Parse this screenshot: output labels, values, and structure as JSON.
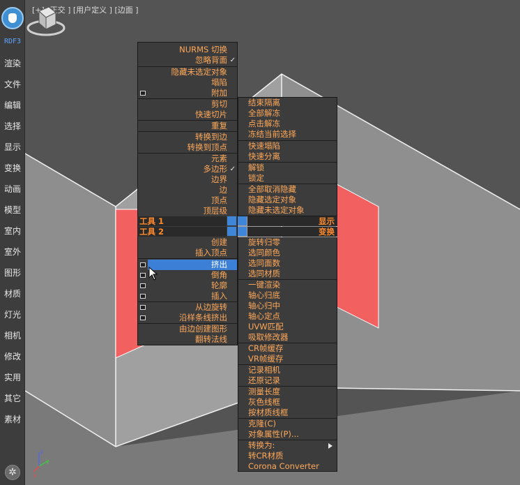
{
  "sidebar": {
    "brand": "RDF3",
    "items": [
      "渲染",
      "文件",
      "编辑",
      "选择",
      "显示",
      "变换",
      "动画",
      "模型",
      "室内",
      "室外",
      "图形",
      "材质",
      "灯光",
      "相机",
      "修改",
      "实用",
      "其它",
      "素材"
    ]
  },
  "viewport": {
    "label": "[+] [正交 ] [用户定义 ] [边面 ]"
  },
  "quad_left": {
    "group1": [
      "NURMS 切换",
      "忽略背面"
    ],
    "group2": [
      "隐藏未选定对象",
      "塌陷",
      "附加"
    ],
    "group3": [
      "剪切",
      "快速切片"
    ],
    "group4": [
      "重复"
    ],
    "group5": [
      "转换到边",
      "转换到顶点"
    ],
    "group6": [
      "元素",
      "多边形",
      "边界",
      "边",
      "顶点",
      "顶层级"
    ],
    "header1": "工具 1",
    "header2": "工具 2",
    "group7": [
      "创建",
      "插入顶点"
    ],
    "group8": [
      "挤出",
      "倒角",
      "轮廓",
      "插入"
    ],
    "group9": [
      "从边旋转",
      "沿样条线挤出"
    ],
    "group10": [
      "由边创建图形",
      "翻转法线"
    ]
  },
  "quad_right": {
    "group1": [
      "结束隔离",
      "全部解冻",
      "点击解冻",
      "冻结当前选择"
    ],
    "group2": [
      "快速塌陷",
      "快速分离"
    ],
    "group3": [
      "解锁",
      "锁定"
    ],
    "group4": [
      "全部取消隐藏",
      "隐藏选定对象",
      "隐藏未选定对象"
    ],
    "header1": "显示",
    "header2": "变换",
    "group5": [
      "旋转归零",
      "选同颜色",
      "选同面数",
      "选同材质"
    ],
    "group6": [
      "一键渲染",
      "轴心归底",
      "轴心归中",
      "轴心定点",
      "UVW匹配",
      "吸取修改器"
    ],
    "group7": [
      "CR帧缓存",
      "VR帧缓存"
    ],
    "group8": [
      "记录相机",
      "还原记录"
    ],
    "group9": [
      "测量长度",
      "灰色线框",
      "按材质线框"
    ],
    "group10": [
      "克隆(C)",
      "对象属性(P)..."
    ],
    "group11": [
      "转换为:",
      "转CR材质",
      "Corona Converter"
    ]
  },
  "colors": {
    "menu_text": "#ffa95a",
    "header_text": "#ff8a2a",
    "highlight": "#3c7fd6",
    "sidebar_brand": "#5ea6ff"
  },
  "icons": [
    "settings-icon",
    "viewcube-icon",
    "axis-gizmo-icon",
    "mouse-cursor-icon",
    "submenu-arrow-icon",
    "checkmark-icon"
  ]
}
